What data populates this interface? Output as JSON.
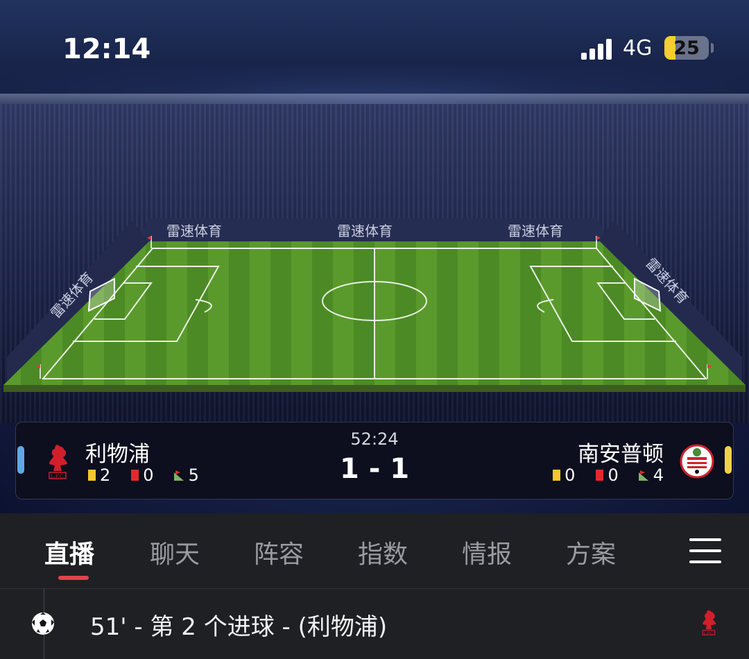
{
  "status_bar": {
    "time": "12:14",
    "network": "4G",
    "battery_level": "25",
    "battery_fraction": 0.25
  },
  "pitch": {
    "ad_boards": [
      "雷速体育",
      "雷速体育",
      "雷速体育",
      "雷速体育",
      "雷速体育"
    ]
  },
  "scoreboard": {
    "clock": "52:24",
    "score": "1 - 1",
    "home": {
      "name": "利物浦",
      "crest_icon": "liverpool-crest-icon",
      "color": "#5fa8e8",
      "yellow_cards": "2",
      "red_cards": "0",
      "corners": "5"
    },
    "away": {
      "name": "南安普顿",
      "crest_icon": "southampton-crest-icon",
      "color": "#f0d24a",
      "yellow_cards": "0",
      "red_cards": "0",
      "corners": "4"
    }
  },
  "tabs": {
    "items": [
      {
        "label": "直播",
        "active": true
      },
      {
        "label": "聊天"
      },
      {
        "label": "阵容"
      },
      {
        "label": "指数"
      },
      {
        "label": "情报"
      },
      {
        "label": "方案"
      }
    ],
    "accent": "#e0434f"
  },
  "events": [
    {
      "text": "51' - 第 2 个进球 - (利物浦)",
      "icon": "soccer-ball-icon",
      "team_icon": "liverpool-crest-icon"
    }
  ]
}
